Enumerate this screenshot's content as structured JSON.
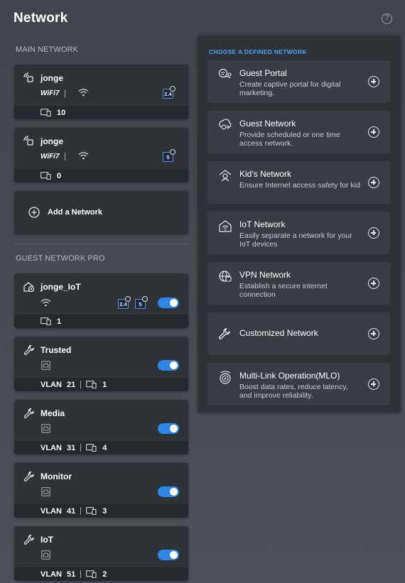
{
  "page": {
    "title": "Network"
  },
  "sections": {
    "main": "MAIN NETWORK",
    "guest_pro": "GUEST NETWORK PRO"
  },
  "main_networks": [
    {
      "name": "jonge",
      "wifi_badge": "WiFi7",
      "bands": [
        "2.4"
      ],
      "clients": "10"
    },
    {
      "name": "jonge",
      "wifi_badge": "WiFi7",
      "bands": [
        "5"
      ],
      "clients": "0"
    }
  ],
  "add_network": {
    "label": "Add a Network"
  },
  "guest_networks": [
    {
      "name": "jonge_IoT",
      "bands": [
        "2.4",
        "5"
      ],
      "enabled": true,
      "clients": "1"
    },
    {
      "name": "Trusted",
      "vlan_label": "VLAN",
      "vlan": "21",
      "enabled": true,
      "clients": "1"
    },
    {
      "name": "Media",
      "vlan_label": "VLAN",
      "vlan": "31",
      "enabled": true,
      "clients": "4"
    },
    {
      "name": "Monitor",
      "vlan_label": "VLAN",
      "vlan": "41",
      "enabled": true,
      "clients": "3"
    },
    {
      "name": "IoT",
      "vlan_label": "VLAN",
      "vlan": "51",
      "enabled": true,
      "clients": "2"
    }
  ],
  "panel": {
    "title": "CHOOSE A DEFINED NETWORK",
    "options": [
      {
        "icon": "captive-portal-icon",
        "title": "Guest Portal",
        "desc": "Create captive portal for digital marketing."
      },
      {
        "icon": "guest-network-icon",
        "title": "Guest Network",
        "desc": "Provide scheduled or one time access network."
      },
      {
        "icon": "kids-network-icon",
        "title": "Kid's Network",
        "desc": "Ensure Internet access safety for kid"
      },
      {
        "icon": "iot-network-icon",
        "title": "IoT Network",
        "desc": "Easily separate a network for your IoT devices"
      },
      {
        "icon": "vpn-globe-icon",
        "title": "VPN Network",
        "desc": "Establish a secure internet connection"
      },
      {
        "icon": "wrench-icon",
        "title": "Customized Network",
        "desc": ""
      },
      {
        "icon": "mlo-icon",
        "title": "Multi-Link Operation(MLO)",
        "desc": "Boost data rates, reduce latency, and improve reliability."
      }
    ]
  },
  "colors": {
    "accent": "#2f86e6",
    "panel_title": "#4ea3ef",
    "card_bg": "#2f3338"
  }
}
